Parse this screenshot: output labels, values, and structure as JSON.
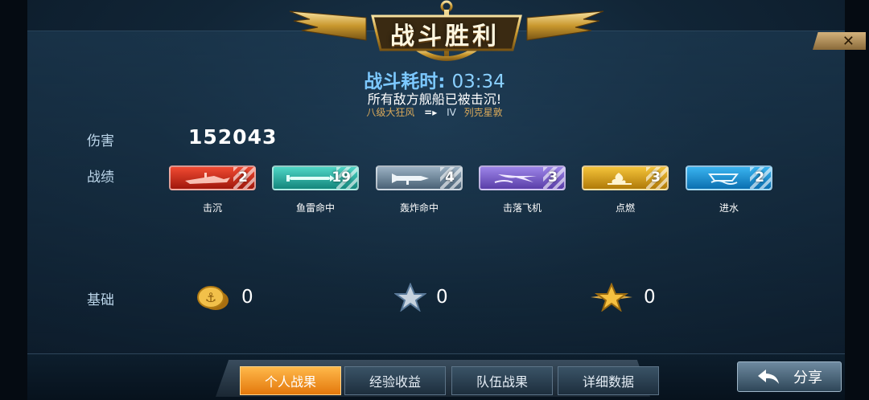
{
  "header": {
    "title": "战斗胜利",
    "close_glyph": "✕"
  },
  "battle": {
    "time_label": "战斗耗时:",
    "time_value": "03:34",
    "result_text": "所有敌方舰船已被击沉!",
    "rank_from": "八级大狂风",
    "rank_arrow": "=▸",
    "rank_level": "IV",
    "rank_to": "列克星敦"
  },
  "damage": {
    "label": "伤害",
    "value": "152043"
  },
  "achievements": {
    "label": "战绩",
    "items": [
      {
        "name": "击沉",
        "count": "2",
        "color": "#e0301c",
        "icon": "ship-sink-icon"
      },
      {
        "name": "鱼雷命中",
        "count": "19",
        "color": "#2fb5a6",
        "icon": "torpedo-icon"
      },
      {
        "name": "轰炸命中",
        "count": "4",
        "color": "#7890a4",
        "icon": "bomb-icon"
      },
      {
        "name": "击落飞机",
        "count": "3",
        "color": "#7a62c8",
        "icon": "plane-down-icon"
      },
      {
        "name": "点燃",
        "count": "3",
        "color": "#d6a016",
        "icon": "fire-icon"
      },
      {
        "name": "进水",
        "count": "2",
        "color": "#1f93d8",
        "icon": "flooding-icon"
      }
    ]
  },
  "base": {
    "label": "基础",
    "coins": "0",
    "silver_star": "0",
    "gold_star": "0"
  },
  "tabs": [
    {
      "label": "个人战果",
      "active": true
    },
    {
      "label": "经验收益",
      "active": false
    },
    {
      "label": "队伍战果",
      "active": false
    },
    {
      "label": "详细数据",
      "active": false
    }
  ],
  "share": {
    "label": "分享"
  }
}
